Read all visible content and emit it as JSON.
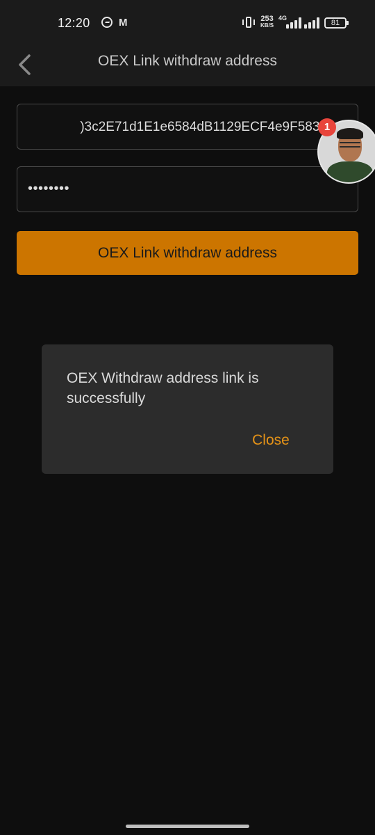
{
  "status_bar": {
    "time": "12:20",
    "net_speed": "253",
    "net_speed_unit": "KB/S",
    "network_type": "4G",
    "battery": "81",
    "icons": [
      "messenger-icon",
      "gmail-icon",
      "vibrate-icon",
      "signal-icon",
      "signal-icon",
      "battery-icon"
    ]
  },
  "header": {
    "title": "OEX Link withdraw address",
    "back_icon": "chevron-left-icon"
  },
  "form": {
    "address_value": ")3c2E71d1E1e6584dB1129ECF4e9F5833",
    "password_value": "••••••••",
    "submit_label": "OEX Link withdraw address",
    "accent_color": "#cc7500"
  },
  "chat_head": {
    "badge_count": "1"
  },
  "dialog": {
    "message": "OEX Withdraw address link is successfully",
    "close_label": "Close",
    "close_color": "#e69317"
  }
}
